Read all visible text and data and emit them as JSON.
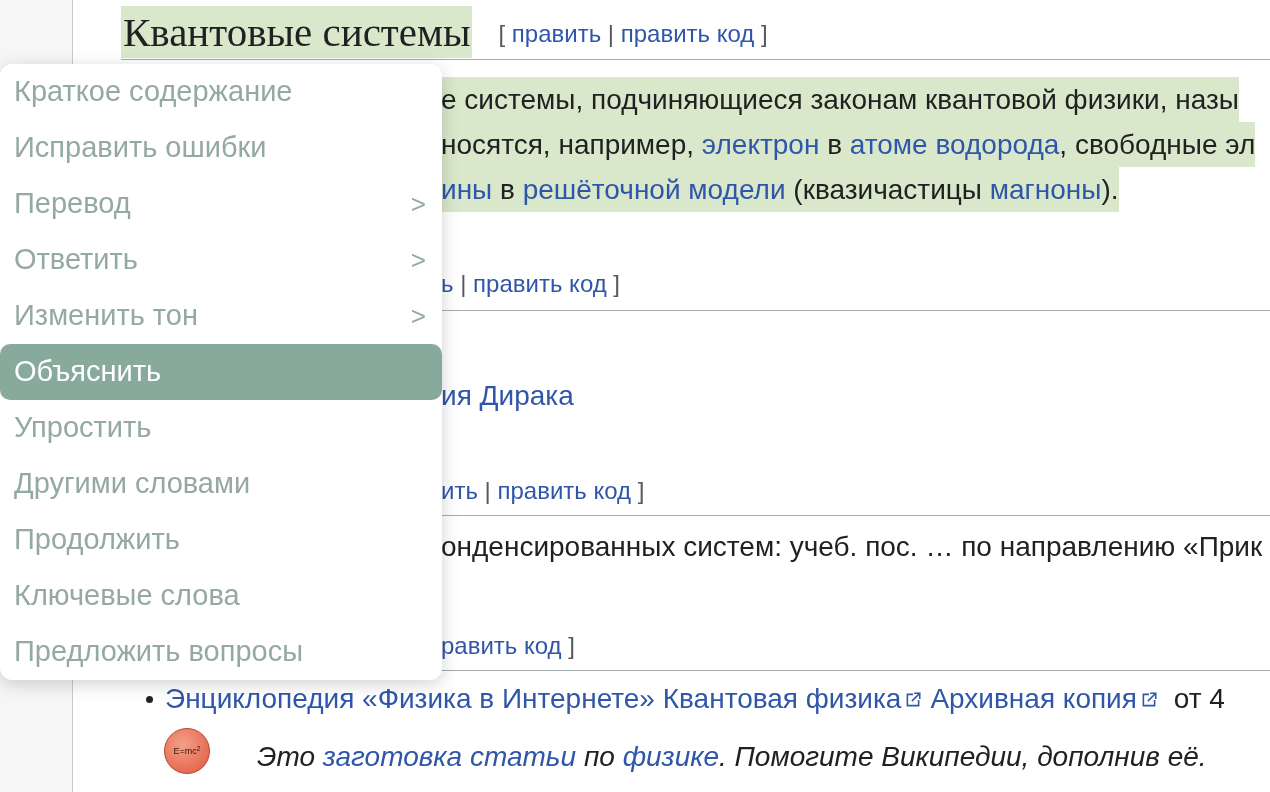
{
  "heading": {
    "text": "Квантовые системы",
    "highlighted": true,
    "edit_links": [
      {
        "text": "[ ",
        "kind": "text"
      },
      {
        "text": "править",
        "kind": "link"
      },
      {
        "text": " | ",
        "kind": "text"
      },
      {
        "text": "править код",
        "kind": "link"
      },
      {
        "text": " ]",
        "kind": "text"
      }
    ]
  },
  "fragments": [
    {
      "kind": "text",
      "highlighted": true,
      "segments": [
        {
          "text": "е системы, подчиняющиеся законам квантовой физики, назы",
          "kind": "text"
        }
      ]
    },
    {
      "kind": "text",
      "highlighted": true,
      "segments": [
        {
          "text": "носятся, например, ",
          "kind": "text"
        },
        {
          "text": "электрон",
          "kind": "link"
        },
        {
          "text": " в ",
          "kind": "text"
        },
        {
          "text": "атоме водорода",
          "kind": "link"
        },
        {
          "text": ", свободные эл",
          "kind": "text"
        }
      ]
    },
    {
      "kind": "text",
      "highlighted": true,
      "segments": [
        {
          "text": "ины",
          "kind": "link"
        },
        {
          "text": " в ",
          "kind": "text"
        },
        {
          "text": "решёточной модели",
          "kind": "link"
        },
        {
          "text": " (квазичастицы ",
          "kind": "text"
        },
        {
          "text": "магноны",
          "kind": "link"
        },
        {
          "text": ").",
          "kind": "text"
        }
      ]
    },
    {
      "kind": "edit",
      "segments": [
        {
          "text": "ь",
          "kind": "link"
        },
        {
          "text": " | ",
          "kind": "text"
        },
        {
          "text": "править код",
          "kind": "link"
        },
        {
          "text": " ]",
          "kind": "text"
        }
      ]
    },
    {
      "kind": "text",
      "segments": [
        {
          "text": "ия Дирака",
          "kind": "link"
        }
      ]
    },
    {
      "kind": "edit",
      "segments": [
        {
          "text": "ить",
          "kind": "link"
        },
        {
          "text": " | ",
          "kind": "text"
        },
        {
          "text": "править код",
          "kind": "link"
        },
        {
          "text": " ]",
          "kind": "text"
        }
      ]
    },
    {
      "kind": "text",
      "segments": [
        {
          "text": "онденсированных систем: учеб. пос. … по направлению «Прик",
          "kind": "text"
        }
      ]
    },
    {
      "kind": "edit",
      "segments": [
        {
          "text": "равить код",
          "kind": "link"
        },
        {
          "text": " ]",
          "kind": "text"
        }
      ]
    },
    {
      "kind": "bullet",
      "segments": [
        {
          "text": "Энциклопедия «Физика в Интернете» Квантовая физика",
          "kind": "extlink"
        },
        {
          "text": "Архивная копия",
          "kind": "extlink"
        },
        {
          "text": " от 4",
          "kind": "text"
        }
      ]
    },
    {
      "kind": "stub",
      "icon_text": "E=mc$^{2}$",
      "segments": [
        {
          "text": "Это ",
          "kind": "text"
        },
        {
          "text": "заготовка статьи",
          "kind": "link"
        },
        {
          "text": " по ",
          "kind": "text"
        },
        {
          "text": "физике",
          "kind": "link"
        },
        {
          "text": ". Помогите Википедии, дополнив её.",
          "kind": "text"
        }
      ]
    }
  ],
  "menu": [
    {
      "label": "Краткое содержание",
      "selected": false
    },
    {
      "label": "Исправить ошибки",
      "selected": false
    },
    {
      "label": "Перевод",
      "selected": false,
      "arrow": ">"
    },
    {
      "label": "Ответить",
      "selected": false,
      "arrow": ">"
    },
    {
      "label": "Изменить тон",
      "selected": false,
      "arrow": ">"
    },
    {
      "label": "Объяснить",
      "selected": true
    },
    {
      "label": "Упростить",
      "selected": false
    },
    {
      "label": "Другими словами",
      "selected": false
    },
    {
      "label": "Продолжить",
      "selected": false
    },
    {
      "label": "Ключевые слова",
      "selected": false
    },
    {
      "label": "Предложить вопросы",
      "selected": false
    }
  ]
}
